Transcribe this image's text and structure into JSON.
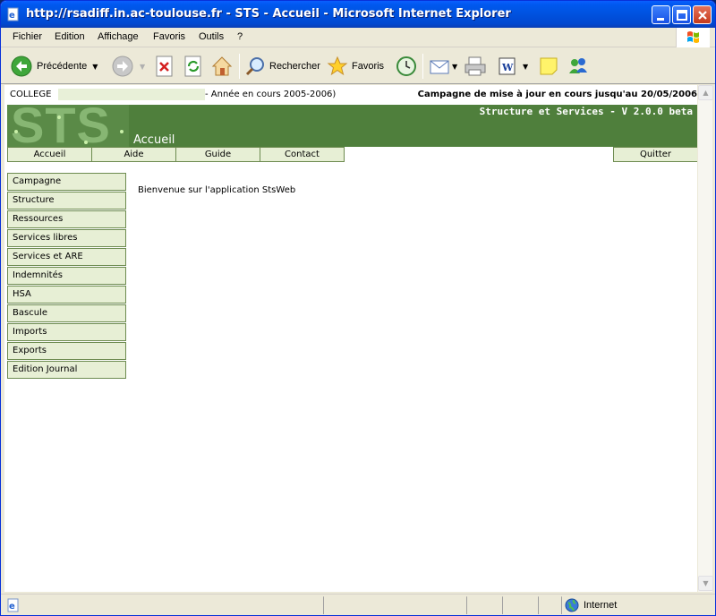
{
  "window": {
    "title": "http://rsadiff.in.ac-toulouse.fr - STS - Accueil - Microsoft Internet Explorer"
  },
  "menubar": {
    "items": [
      "Fichier",
      "Edition",
      "Affichage",
      "Favoris",
      "Outils",
      "?"
    ]
  },
  "toolbar": {
    "back_label": "Précédente",
    "search_label": "Rechercher",
    "favorites_label": "Favoris"
  },
  "page": {
    "college_label": "COLLEGE",
    "annee": "- Année en cours 2005-2006)",
    "campagne": "Campagne de mise à jour en cours jusqu'au 20/05/2006",
    "app_title": "Structure et Services - V 2.0.0 beta",
    "logo_text": "STS",
    "page_title": "Accueil",
    "topnav": [
      "Accueil",
      "Aide",
      "Guide",
      "Contact"
    ],
    "quit_label": "Quitter",
    "side_menu": [
      "Campagne",
      "Structure",
      "Ressources",
      "Services libres",
      "Services et ARE",
      "Indemnités",
      "HSA",
      "Bascule",
      "Imports",
      "Exports",
      "Edition Journal"
    ],
    "welcome": "Bienvenue sur l'application StsWeb"
  },
  "statusbar": {
    "zone": "Internet"
  },
  "colors": {
    "banner": "#4f7f3c",
    "menu_bg": "#e7efd5",
    "menu_border": "#6d8b50"
  }
}
